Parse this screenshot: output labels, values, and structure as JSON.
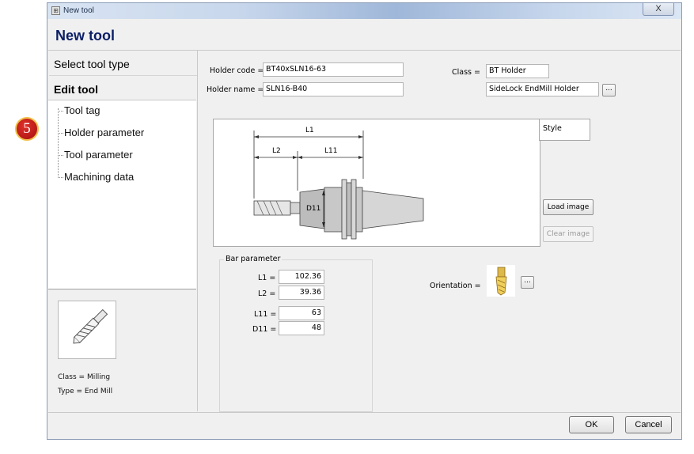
{
  "window": {
    "title": "New tool",
    "icon_name": "app-icon",
    "close_label": "X"
  },
  "header": {
    "title": "New tool"
  },
  "nav": {
    "steps": [
      {
        "label": "Select tool type"
      },
      {
        "label": "Edit tool"
      }
    ],
    "tree": [
      {
        "label": "Tool tag"
      },
      {
        "label": "Holder parameter"
      },
      {
        "label": "Tool parameter"
      },
      {
        "label": "Machining data"
      }
    ]
  },
  "tool_info": {
    "thumbnail_icon": "end-mill-icon",
    "class_text": "Class = Milling",
    "type_text": "Type = End Mill"
  },
  "holder": {
    "code_label": "Holder code =",
    "code_value": "BT40xSLN16-63",
    "name_label": "Holder name =",
    "name_value": "SLN16-B40",
    "class_label": "Class =",
    "class_value": "BT Holder",
    "class_sub_value": "SideLock EndMill Holder",
    "browse_label": "..."
  },
  "diagram": {
    "dims": [
      "L1",
      "L2",
      "L11",
      "D11"
    ]
  },
  "style": {
    "label": "Style"
  },
  "image_buttons": {
    "load": "Load image",
    "clear": "Clear image"
  },
  "bar_parameter": {
    "title": "Bar parameter",
    "rows": [
      {
        "label": "L1 =",
        "value": "102.36"
      },
      {
        "label": "L2 =",
        "value": "39.36"
      },
      {
        "label": "L11 =",
        "value": "63"
      },
      {
        "label": "D11 =",
        "value": "48"
      }
    ]
  },
  "orientation": {
    "label": "Orientation =",
    "icon_name": "tool-orientation-icon",
    "browse_label": "..."
  },
  "footer": {
    "ok": "OK",
    "cancel": "Cancel"
  },
  "step_badge": {
    "number": "5"
  },
  "colors": {
    "header_title": "#0b1e66",
    "badge": "#c91d1d"
  }
}
